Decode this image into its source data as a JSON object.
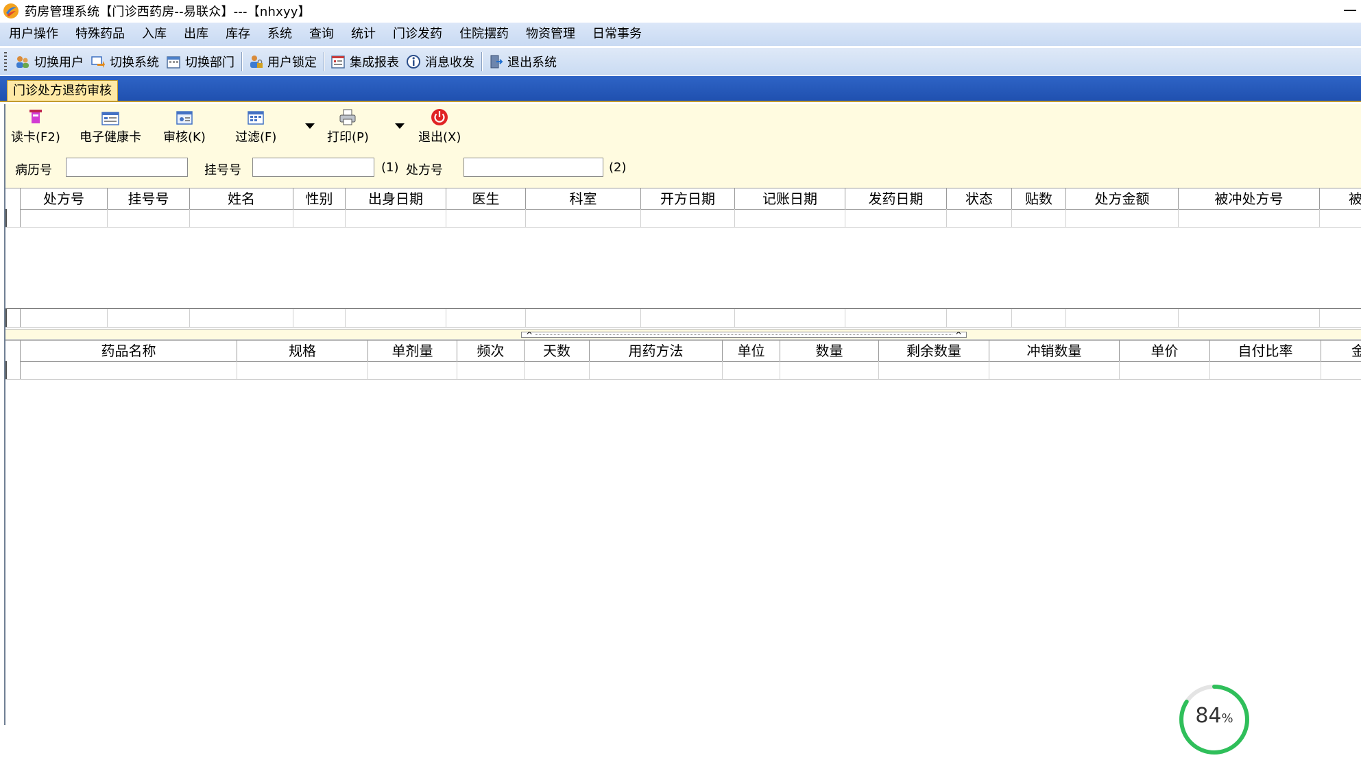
{
  "window": {
    "title": "药房管理系统【门诊西药房--易联众】---【nhxyy】",
    "minimize_glyph": "—"
  },
  "menubar": {
    "items": [
      "用户操作",
      "特殊药品",
      "入库",
      "出库",
      "库存",
      "系统",
      "查询",
      "统计",
      "门诊发药",
      "住院摆药",
      "物资管理",
      "日常事务"
    ]
  },
  "toolbar": {
    "switch_user": "切换用户",
    "switch_system": "切换系统",
    "switch_dept": "切换部门",
    "user_lock": "用户锁定",
    "report": "集成报表",
    "message": "消息收发",
    "exit_system": "退出系统"
  },
  "tab": {
    "label": "门诊处方退药审核"
  },
  "commands": {
    "read_card": "读卡(F2)",
    "health_card": "电子健康卡",
    "audit": "审核(K)",
    "filter": "过滤(F)",
    "print": "打印(P)",
    "exit": "退出(X)"
  },
  "search": {
    "record_label": "病历号",
    "record_value": "",
    "reg_label": "挂号号",
    "reg_value": "",
    "reg_hint": "(1)",
    "rx_label": "处方号",
    "rx_value": "",
    "rx_hint": "(2)"
  },
  "top_grid": {
    "columns": [
      "处方号",
      "挂号号",
      "姓名",
      "性别",
      "出身日期",
      "医生",
      "科室",
      "开方日期",
      "记账日期",
      "发药日期",
      "状态",
      "贴数",
      "处方金额",
      "被冲处方号",
      "被"
    ]
  },
  "bottom_grid": {
    "columns": [
      "药品名称",
      "规格",
      "单剂量",
      "频次",
      "天数",
      "用药方法",
      "单位",
      "数量",
      "剩余数量",
      "冲销数量",
      "单价",
      "自付比率",
      "金"
    ]
  },
  "progress": {
    "value": "84",
    "unit": "%",
    "fraction": 0.84,
    "color": "#2fbf5a"
  },
  "colors": {
    "menu_bg": "#c8daf3",
    "tab_strip": "#1f4fae",
    "tab_active": "#ffe9a6",
    "panel_bg": "#fffbe0"
  }
}
